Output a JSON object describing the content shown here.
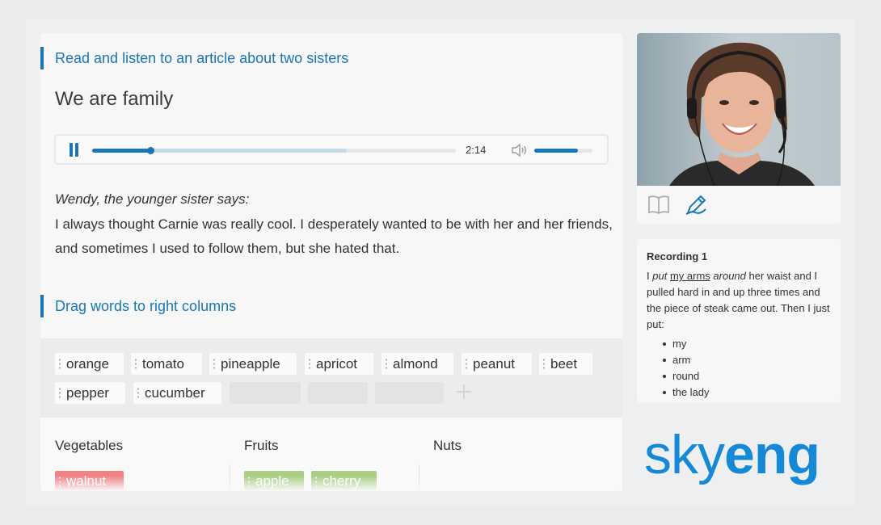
{
  "lesson": {
    "section1_title": "Read and listen to an article about two sisters",
    "article_title": "We are family",
    "speaker": "Wendy, the younger sister says:",
    "text": "I always thought Carnie was really cool. I desperately wanted to be with her and her friends, and sometimes I used to follow them, but she hated that.",
    "section2_title": "Drag words to right columns"
  },
  "player": {
    "time": "2:14",
    "progress_fraction": 0.16,
    "buffered_fraction": 0.7,
    "volume_fraction": 0.75
  },
  "word_bank": {
    "words": [
      "orange",
      "tomato",
      "pineapple",
      "apricot",
      "almond",
      "peanut",
      "beet",
      "pepper",
      "cucumber"
    ],
    "empty_slots": 3
  },
  "columns": [
    {
      "title": "Vegetables",
      "items": [
        {
          "label": "walnut",
          "status": "wrong"
        }
      ]
    },
    {
      "title": "Fruits",
      "items": [
        {
          "label": "apple",
          "status": "correct"
        },
        {
          "label": "cherry",
          "status": "correct"
        }
      ]
    },
    {
      "title": "Nuts",
      "items": []
    }
  ],
  "recording": {
    "title": "Recording 1",
    "p1": "I ",
    "w_put": "put",
    "p2": " ",
    "w_myarms": "my arms",
    "p3": " ",
    "w_around": "around",
    "p4": " her waist and I pulled hard in and up three times and the piece of steak came out. Then I just put:",
    "list": [
      "my",
      "arm",
      "round",
      "the lady"
    ]
  },
  "brand": {
    "logo_light": "sky",
    "logo_bold": "eng",
    "color": "#1689d6"
  },
  "colors": {
    "accent": "#1a76b4",
    "wrong": "#f08284",
    "correct": "#a8cf85"
  },
  "icons": [
    "pause-icon",
    "volume-icon",
    "book-icon",
    "pen-icon",
    "plus-icon"
  ]
}
